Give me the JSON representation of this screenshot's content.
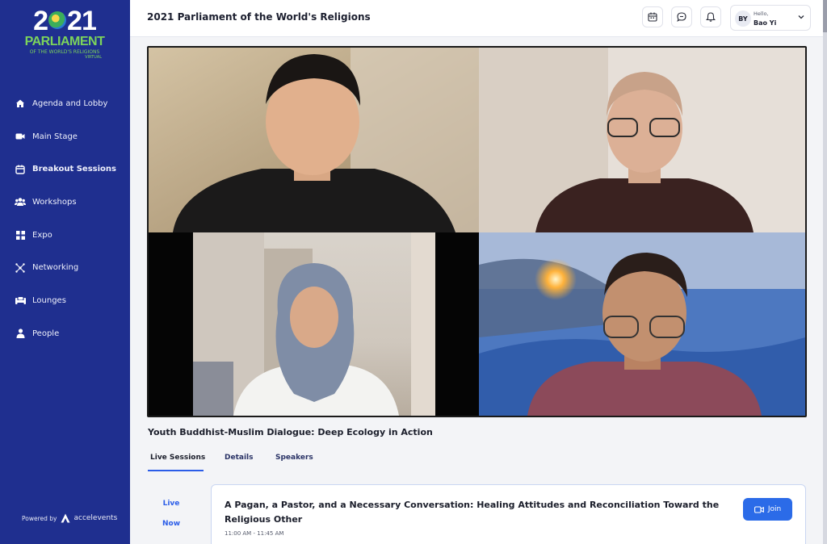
{
  "app": {
    "logo": {
      "year": "2021",
      "main": "PARLIAMENT",
      "sub": "OF THE WORLD'S RELIGIONS",
      "tag": "VIRTUAL"
    },
    "title": "2021 Parliament of the World's Religions"
  },
  "sidebar": {
    "items": [
      {
        "label": "Agenda and Lobby",
        "icon": "home-icon"
      },
      {
        "label": "Main Stage",
        "icon": "video-camera-icon"
      },
      {
        "label": "Breakout Sessions",
        "icon": "calendar-icon",
        "active": true
      },
      {
        "label": "Workshops",
        "icon": "group-icon"
      },
      {
        "label": "Expo",
        "icon": "grid-icon"
      },
      {
        "label": "Networking",
        "icon": "network-icon"
      },
      {
        "label": "Lounges",
        "icon": "lounge-icon"
      },
      {
        "label": "People",
        "icon": "person-icon"
      }
    ],
    "powered_by": "Powered by",
    "brand": "accelevents"
  },
  "header": {
    "icons": [
      "calendar-icon",
      "chat-icon",
      "bell-icon"
    ],
    "user": {
      "initials": "BY",
      "greeting": "Hello,",
      "name": "Bao Yi"
    }
  },
  "main": {
    "session_title": "Youth Buddhist-Muslim Dialogue: Deep Ecology in Action",
    "tabs": [
      {
        "label": "Live Sessions",
        "active": true
      },
      {
        "label": "Details"
      },
      {
        "label": "Speakers"
      }
    ],
    "live_label_1": "Live",
    "live_label_2": "Now",
    "card": {
      "title": "A Pagan, a Pastor, and a Necessary Conversation: Healing Attitudes and Reconciliation Toward the Religious Other",
      "time": "11:00 AM - 11:45 AM",
      "join_label": "Join"
    }
  },
  "colors": {
    "sidebar": "#1f2f8f",
    "accent": "#2b6be8",
    "logo_green": "#7cd45b"
  }
}
